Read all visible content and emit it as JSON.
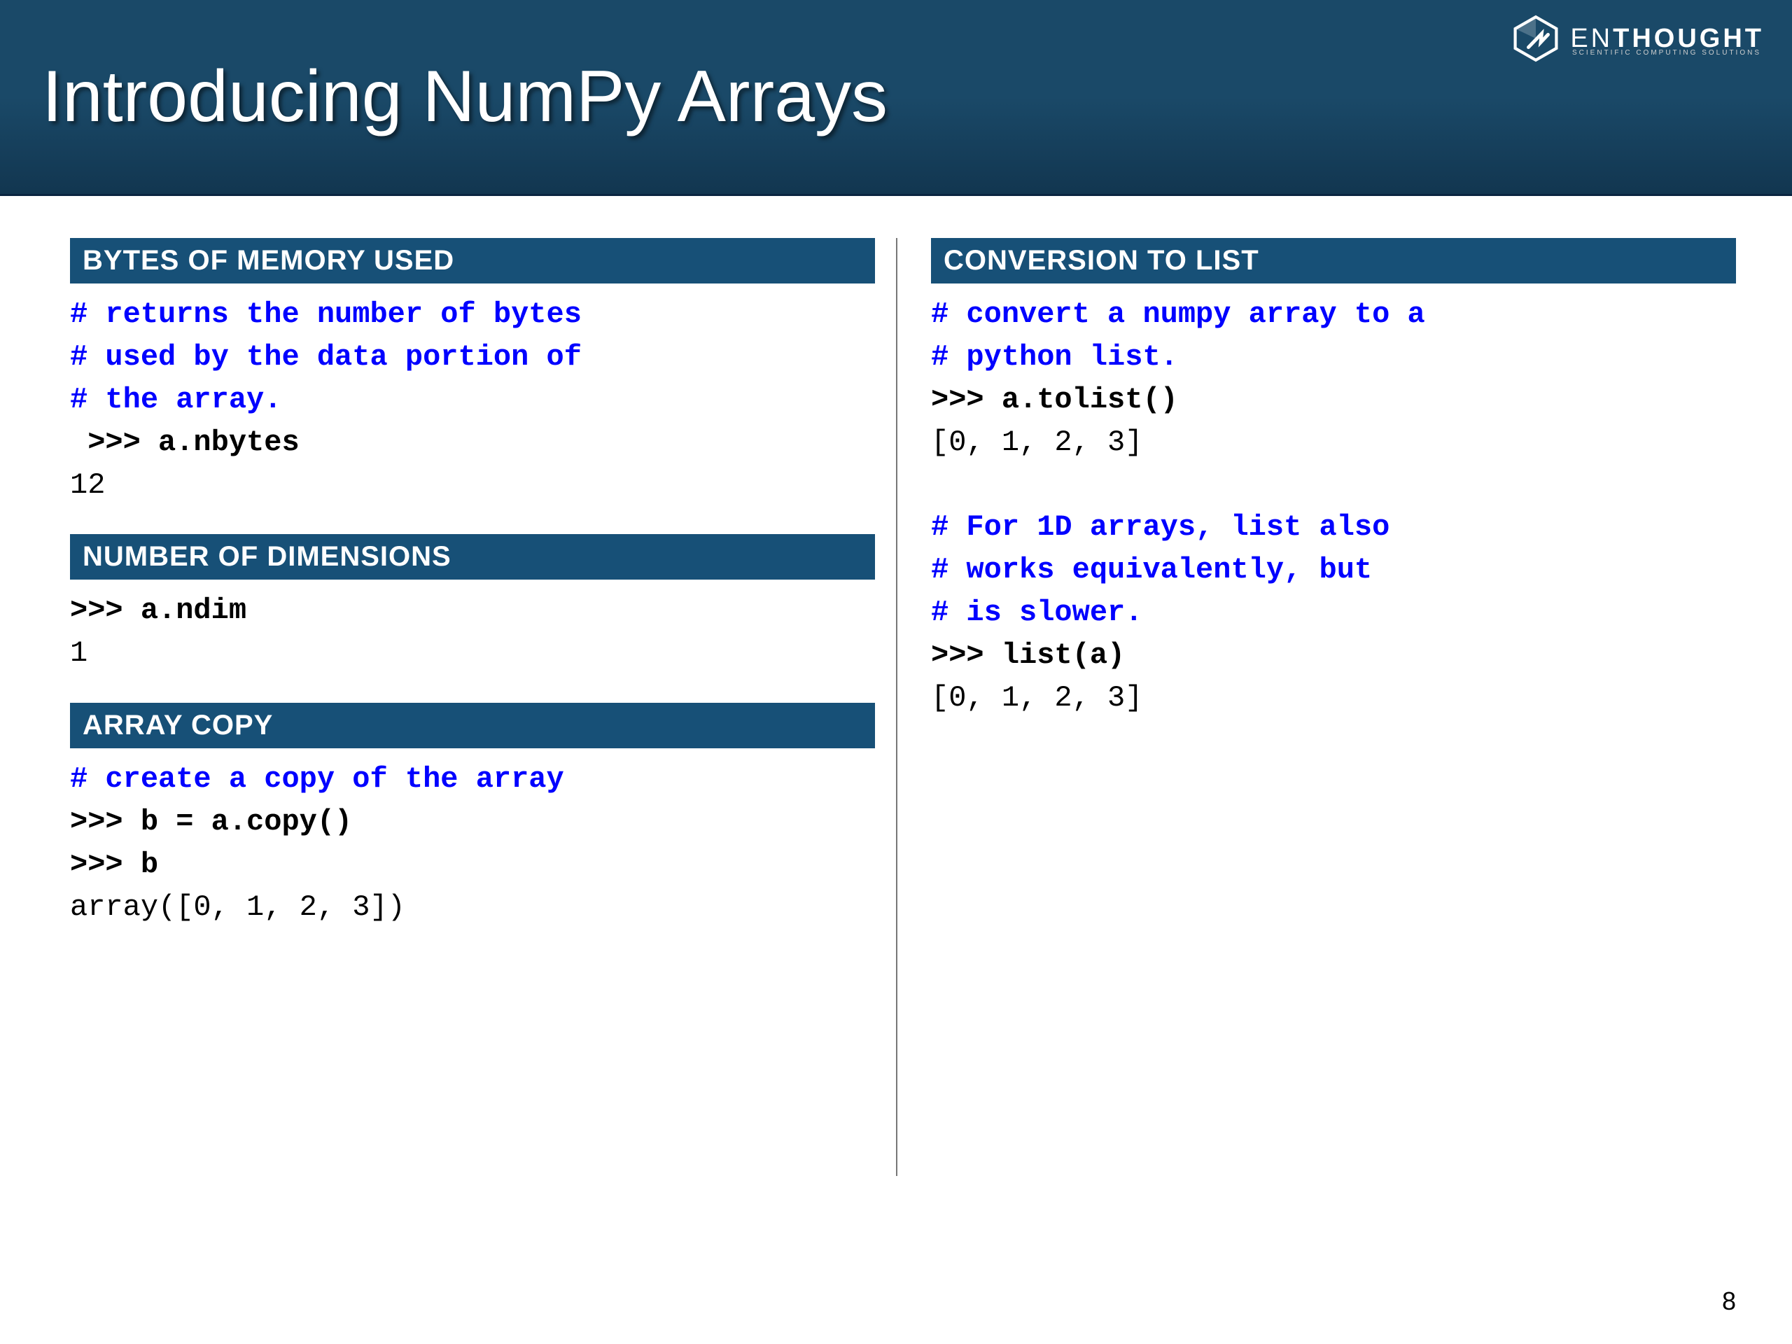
{
  "header": {
    "title": "Introducing NumPy Arrays",
    "logo_main": "ENTHOUGHT",
    "logo_sub": "SCIENTIFIC COMPUTING SOLUTIONS"
  },
  "sections": {
    "bytes": {
      "title": "BYTES OF MEMORY USED",
      "comment1": "# returns the number of bytes",
      "comment2": "# used by the data portion of",
      "comment3": "# the array.",
      "prompt1": " >>> a.nbytes",
      "output1": "12"
    },
    "dims": {
      "title": "NUMBER OF DIMENSIONS",
      "prompt1": ">>> a.ndim",
      "output1": "1"
    },
    "copy": {
      "title": "ARRAY COPY",
      "comment1": "# create a copy of the array",
      "prompt1": ">>> b = a.copy()",
      "prompt2": ">>> b",
      "output1": "array([0, 1, 2, 3])"
    },
    "tolist": {
      "title": "CONVERSION TO LIST",
      "comment1": "# convert a numpy array to a",
      "comment2": "# python list.",
      "prompt1": ">>> a.tolist()",
      "output1": "[0, 1, 2, 3]",
      "comment3": "# For 1D arrays, list also",
      "comment4": "# works equivalently, but",
      "comment5": "# is slower.",
      "prompt2": ">>> list(a)",
      "output2": "[0, 1, 2, 3]"
    }
  },
  "page_number": "8"
}
